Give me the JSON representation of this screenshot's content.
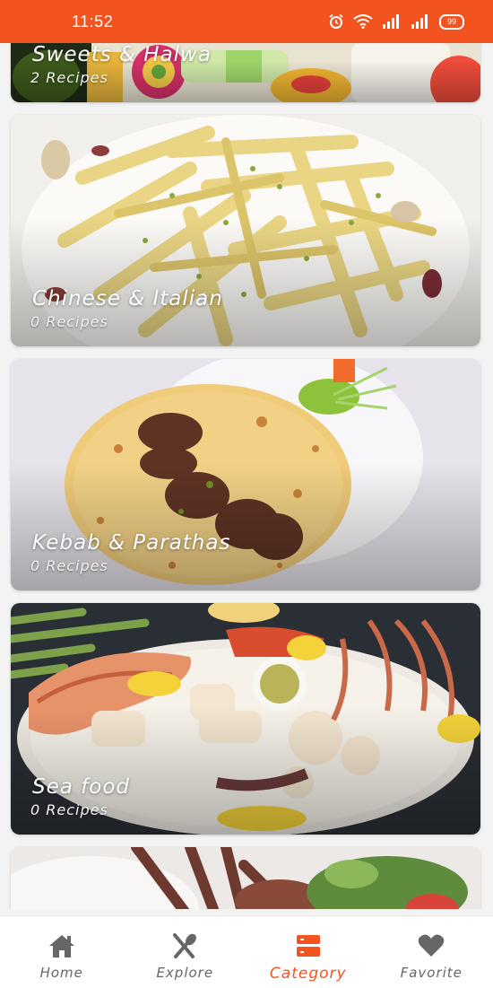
{
  "status_bar": {
    "time": "11:52",
    "battery": "99",
    "icons": [
      "alarm-icon",
      "wifi-icon",
      "signal-icon",
      "signal-icon",
      "battery-icon"
    ]
  },
  "categories": [
    {
      "title": "Sweets & Halwa",
      "count": "2 Recipes"
    },
    {
      "title": "Chinese & Italian",
      "count": "0 Recipes"
    },
    {
      "title": "Kebab & Parathas",
      "count": "0 Recipes"
    },
    {
      "title": "Sea food",
      "count": "0 Recipes"
    },
    {
      "title": "",
      "count": ""
    }
  ],
  "bottom_nav": {
    "items": [
      {
        "label": "Home",
        "icon": "home-icon"
      },
      {
        "label": "Explore",
        "icon": "fork-spoon-icon"
      },
      {
        "label": "Category",
        "icon": "category-icon",
        "active": true
      },
      {
        "label": "Favorite",
        "icon": "heart-icon"
      }
    ]
  },
  "colors": {
    "accent": "#f2531f",
    "nav_inactive": "#666666",
    "background": "#f3f3f3"
  }
}
